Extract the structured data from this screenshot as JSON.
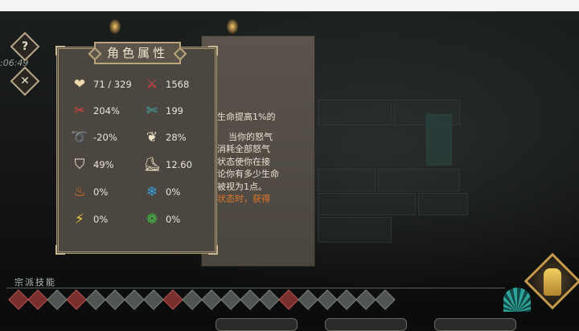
{
  "panel": {
    "title": "角色属性",
    "stats": [
      {
        "icon": "heart-icon",
        "value": "71 / 329"
      },
      {
        "icon": "attack-icon",
        "value": "1568"
      },
      {
        "icon": "crit-rate-icon",
        "value": "204%"
      },
      {
        "icon": "crit-damage-icon",
        "value": "199"
      },
      {
        "icon": "dodge-icon",
        "value": "-20%"
      },
      {
        "icon": "wing-icon",
        "value": "28%"
      },
      {
        "icon": "shield-icon",
        "value": "49%"
      },
      {
        "icon": "boot-icon",
        "value": "12.60"
      },
      {
        "icon": "fire-icon",
        "value": "0%"
      },
      {
        "icon": "ice-icon",
        "value": "0%"
      },
      {
        "icon": "lightning-icon",
        "value": "0%"
      },
      {
        "icon": "poison-icon",
        "value": "0%"
      }
    ]
  },
  "description": {
    "lines": [
      "生命提高1%的",
      "当你的怒气",
      "消耗全部怒气",
      "状态使你在接",
      "论你有多少生命",
      "被视为1点。"
    ],
    "highlight": "状态时，获得"
  },
  "hud": {
    "help_label": "?",
    "close_label": "✕",
    "timer": ":06:49"
  },
  "skills": {
    "label": "宗派技能"
  },
  "colors": {
    "stat_text": "#ece6d6",
    "highlight": "#e0772c",
    "frame": "#bba57a"
  }
}
